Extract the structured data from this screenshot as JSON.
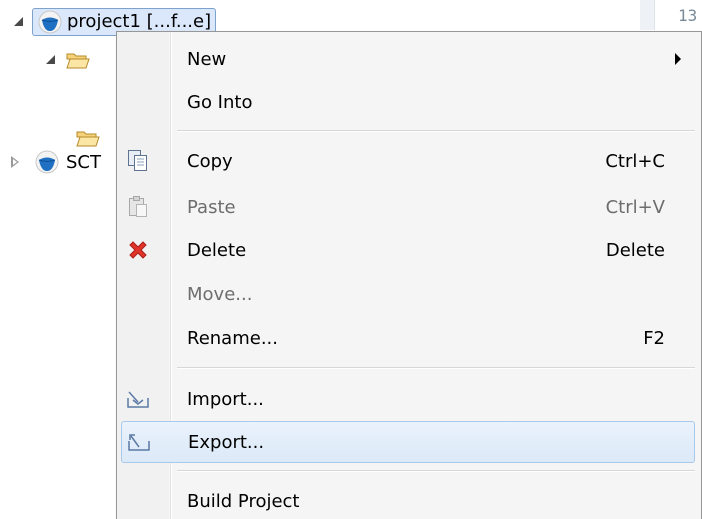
{
  "tree": {
    "project": {
      "label": "project1 [...f...e]",
      "icon": "project-icon"
    },
    "folder_expanded": {
      "icon": "folder-open-icon"
    },
    "folder_plain": {
      "icon": "folder-open-icon"
    },
    "sct_project": {
      "label": "SCT",
      "icon": "project-icon"
    }
  },
  "editor": {
    "line_number": "13"
  },
  "context_menu": {
    "items": [
      {
        "label": "New",
        "accel": "",
        "icon": "",
        "submenu": true
      },
      {
        "label": "Go Into",
        "accel": "",
        "icon": ""
      },
      {
        "label": "Copy",
        "accel": "Ctrl+C",
        "icon": "copy-icon"
      },
      {
        "label": "Paste",
        "accel": "Ctrl+V",
        "icon": "paste-icon",
        "disabled": true
      },
      {
        "label": "Delete",
        "accel": "Delete",
        "icon": "delete-icon"
      },
      {
        "label": "Move...",
        "accel": "",
        "icon": "",
        "disabled": true
      },
      {
        "label": "Rename...",
        "accel": "F2",
        "icon": ""
      },
      {
        "label": "Import...",
        "accel": "",
        "icon": "import-icon"
      },
      {
        "label": "Export...",
        "accel": "",
        "icon": "export-icon",
        "highlighted": true
      },
      {
        "label": "Build Project",
        "accel": "",
        "icon": ""
      }
    ]
  },
  "colors": {
    "delete_icon": "#e0342b",
    "highlight_border": "#a8c8ec",
    "folder": "#e8b84a"
  }
}
